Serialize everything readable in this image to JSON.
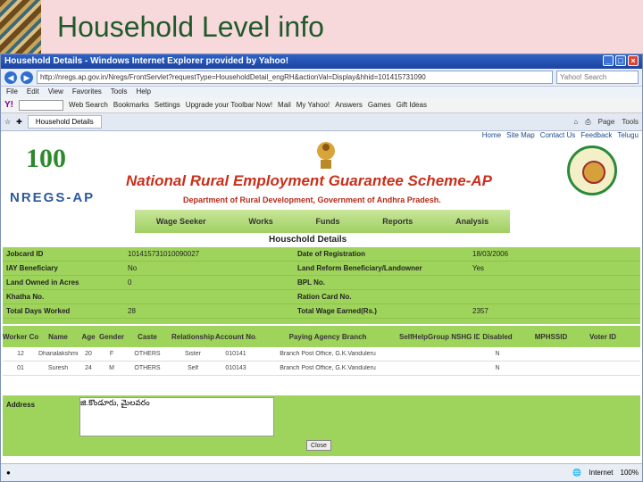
{
  "slide": {
    "title": "Household Level info"
  },
  "browser": {
    "window_title": "Household Details - Windows Internet Explorer provided by Yahoo!",
    "url": "http://nregs.ap.gov.in/Nregs/FrontServlet?requestType=HouseholdDetail_engRH&actionVal=Display&hhid=101415731090",
    "search_placeholder": "Yahoo! Search",
    "menu": [
      "File",
      "Edit",
      "View",
      "Favorites",
      "Tools",
      "Help"
    ],
    "yahoo_toolbar": {
      "logo": "Y!",
      "search_btn": "Web Search",
      "bookmarks": "Bookmarks",
      "settings": "Settings",
      "upgrade": "Upgrade your Toolbar Now!",
      "mail": "Mail",
      "my_yahoo": "My Yahoo!",
      "answers": "Answers",
      "games": "Games",
      "gift": "Gift Ideas"
    },
    "tab_label": "Household Details",
    "tab_tools": [
      "Page",
      "Tools"
    ],
    "status_zone": "Internet",
    "zoom": "100%"
  },
  "site": {
    "toplinks": [
      "Home",
      "Site Map",
      "Contact Us",
      "Feedback",
      "Telugu"
    ],
    "logo_number": "100",
    "logo_text": "NREGS-AP",
    "scheme_title": "National Rural Employment Guarantee Scheme-AP",
    "dept": "Department of Rural Development, Government of Andhra Pradesh.",
    "nav": [
      "Wage Seeker",
      "Works",
      "Funds",
      "Reports",
      "Analysis"
    ],
    "heading": "Houschold Details"
  },
  "details": [
    {
      "l1": "Jobcard ID",
      "v1": "101415731010090027",
      "l2": "Date of Registration",
      "v2": "18/03/2006"
    },
    {
      "l1": "IAY Beneficiary",
      "v1": "No",
      "l2": "Land Reform Beneficiary/Landowner",
      "v2": "Yes"
    },
    {
      "l1": "Land Owned in Acres",
      "v1": "0",
      "l2": "BPL No.",
      "v2": ""
    },
    {
      "l1": "Khatha No.",
      "v1": "",
      "l2": "Ration Card No.",
      "v2": ""
    },
    {
      "l1": "Total Days Worked",
      "v1": "28",
      "l2": "Total Wage Earned(Rs.)",
      "v2": "2357"
    }
  ],
  "worker_headers": [
    "Worker Code",
    "Name",
    "Age",
    "Gender",
    "Caste",
    "Relationship",
    "Account No.",
    "Paying Agency Branch",
    "SelfHelpGroup Name",
    "SHG ID",
    "Disabled",
    "MPHSSID",
    "Voter ID"
  ],
  "workers": [
    [
      "12",
      "Dhanalakshmi",
      "20",
      "F",
      "OTHERS",
      "Sister",
      "010141",
      "Branch Post Office, G.K.Vanduleru",
      "",
      "",
      "N",
      "",
      ""
    ],
    [
      "01",
      "Suresh",
      "24",
      "M",
      "OTHERS",
      "Self",
      "010143",
      "Branch Post Office, G.K.Vanduleru",
      "",
      "",
      "N",
      "",
      ""
    ]
  ],
  "address": {
    "label": "Address",
    "value": "జి.కొండూరు, మైలవరం",
    "close_btn": "Close"
  }
}
